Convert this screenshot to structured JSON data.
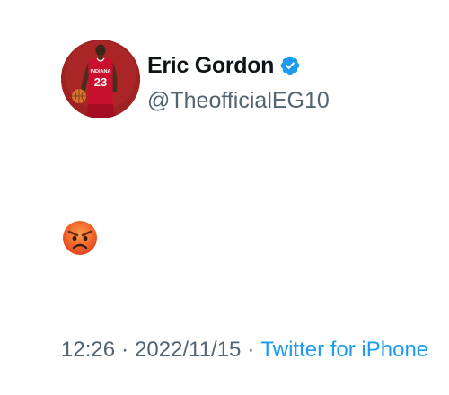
{
  "tweet": {
    "author": {
      "display_name": "Eric Gordon",
      "handle": "@TheofficialEG10",
      "verified": true,
      "jersey_text": "INDIANA",
      "jersey_number": "23"
    },
    "content": {
      "emoji": "😡",
      "emoji_name": "angry-face-emoji"
    },
    "meta": {
      "time": "12:26",
      "separator": "·",
      "date": "2022/11/15",
      "source": "Twitter for iPhone"
    }
  },
  "colors": {
    "accent": "#1d9bf0",
    "secondary_text": "#536471",
    "primary_text": "#0f1419",
    "avatar_background": "#962020",
    "jersey": "#c8102e"
  },
  "icons": {
    "verified": "verified-badge-icon"
  }
}
